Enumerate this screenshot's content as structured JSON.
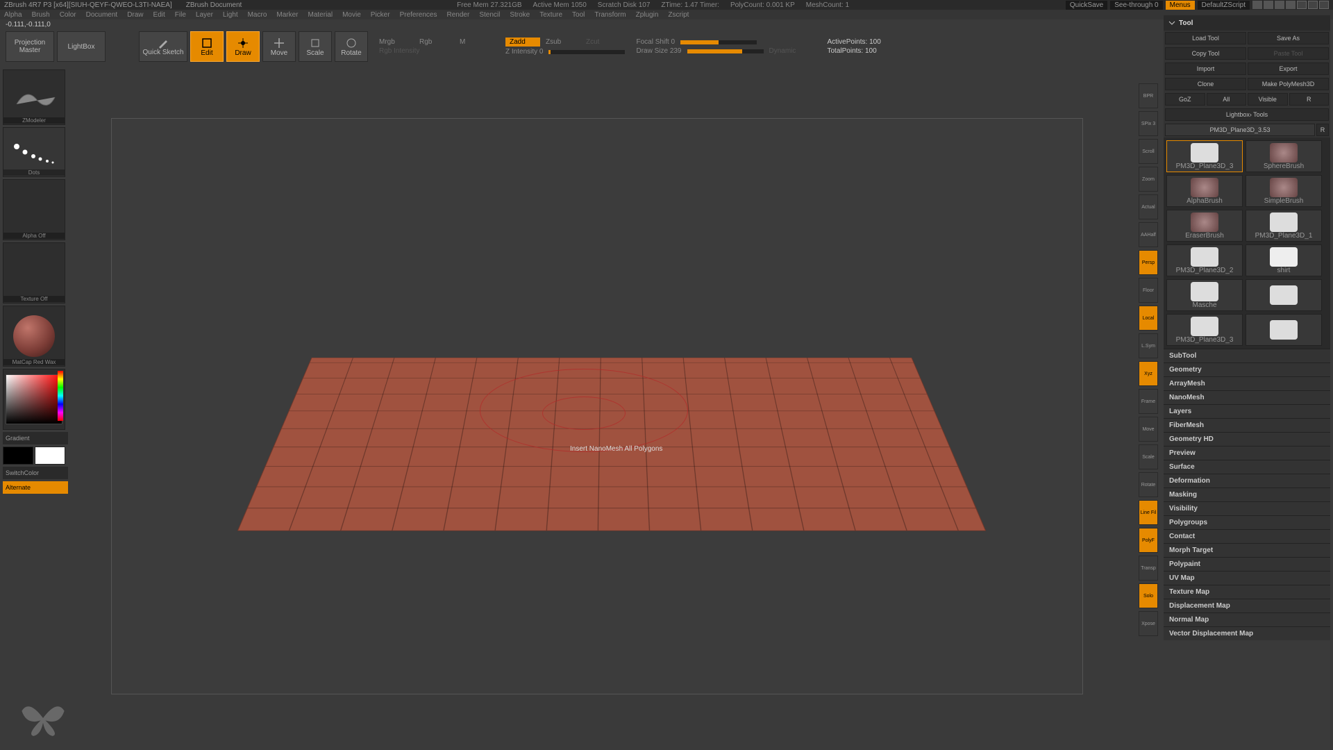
{
  "title": {
    "app": "ZBrush 4R7 P3 [x64][SIUH-QEYF-QWEO-L3TI-NAEA]",
    "doc": "ZBrush Document",
    "stats": [
      "Free Mem 27.321GB",
      "Active Mem 1050",
      "Scratch Disk 107",
      "ZTime: 1.47 Timer:",
      "PolyCount: 0.001 KP",
      "MeshCount: 1"
    ],
    "quicksave": "QuickSave",
    "seethrough": "See-through  0",
    "menus": "Menus",
    "defaultscript": "DefaultZScript"
  },
  "menubar": [
    "Alpha",
    "Brush",
    "Color",
    "Document",
    "Draw",
    "Edit",
    "File",
    "Layer",
    "Light",
    "Macro",
    "Marker",
    "Material",
    "Movie",
    "Picker",
    "Preferences",
    "Render",
    "Stencil",
    "Stroke",
    "Texture",
    "Tool",
    "Transform",
    "Zplugin",
    "Zscript"
  ],
  "statusline": "-0.111,-0.111,0",
  "toolbar": {
    "projection": "Projection\nMaster",
    "lightbox": "LightBox",
    "quicksketch": "Quick\nSketch",
    "edit": "Edit",
    "draw": "Draw",
    "move": "Move",
    "scale": "Scale",
    "rotate": "Rotate",
    "mrgb": "Mrgb",
    "rgb": "Rgb",
    "m": "M",
    "rgbint": "Rgb Intensity",
    "zadd": "Zadd",
    "zsub": "Zsub",
    "zcut": "Zcut",
    "zint": "Z Intensity 0",
    "focal": "Focal Shift 0",
    "drawsize": "Draw Size 239",
    "dynamic": "Dynamic",
    "activepoints": "ActivePoints: 100",
    "totalpoints": "TotalPoints: 100"
  },
  "leftpanel": {
    "brush_lbl": "ZModeler",
    "stroke_lbl": "Dots",
    "alpha_lbl": "Alpha Off",
    "texture_lbl": "Texture Off",
    "material_lbl": "MatCap Red Wax",
    "gradient": "Gradient",
    "switchcolor": "SwitchColor",
    "alternate": "Alternate"
  },
  "canvas": {
    "tooltip": "Insert NanoMesh All Polygons"
  },
  "rightstrip": [
    "BPR",
    "SPix 3",
    "Scroll",
    "Zoom",
    "Actual",
    "AAHalf",
    "Persp",
    "Floor",
    "Local",
    "L.Sym",
    "Xyz",
    "Frame",
    "Move",
    "Scale",
    "Rotate",
    "Line Fil",
    "PolyF",
    "Transp",
    "Solo",
    "Xpose"
  ],
  "rightstrip_active": [
    "Persp",
    "Local",
    "Xyz",
    "Line Fil",
    "PolyF",
    "Solo"
  ],
  "rightpanel": {
    "title": "Tool",
    "rows": [
      [
        "Load Tool",
        "Save As"
      ],
      [
        "Copy Tool",
        "Paste Tool"
      ],
      [
        "Import",
        "Export"
      ],
      [
        "Clone",
        "Make PolyMesh3D"
      ],
      [
        "GoZ",
        "All",
        "Visible",
        "R"
      ]
    ],
    "lightbox": "Lightbox› Tools",
    "activeTool": "PM3D_Plane3D_3.53",
    "tools": [
      "PM3D_Plane3D_3",
      "SphereBrush",
      "AlphaBrush",
      "SimpleBrush",
      "EraserBrush",
      "PM3D_Plane3D_1",
      "PM3D_Plane3D_2",
      "shirt",
      "Masche",
      "",
      "PM3D_Plane3D_3",
      ""
    ],
    "sections": [
      "SubTool",
      "Geometry",
      "ArrayMesh",
      "NanoMesh",
      "Layers",
      "FiberMesh",
      "Geometry HD",
      "Preview",
      "Surface",
      "Deformation",
      "Masking",
      "Visibility",
      "Polygroups",
      "Contact",
      "Morph Target",
      "Polypaint",
      "UV Map",
      "Texture Map",
      "Displacement Map",
      "Normal Map",
      "Vector Displacement Map"
    ]
  }
}
